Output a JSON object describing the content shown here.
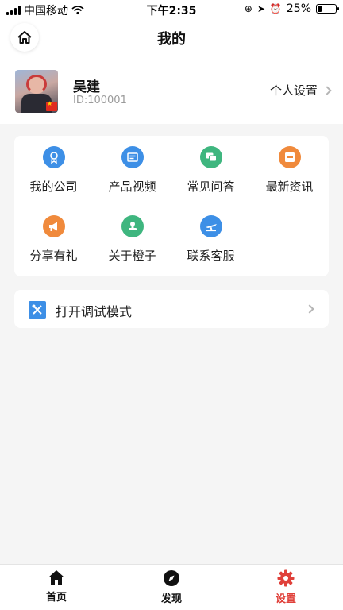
{
  "status_bar": {
    "carrier": "中国移动",
    "time": "下午2:35",
    "battery": "25%",
    "battery_level": 0.25
  },
  "header": {
    "title": "我的",
    "home_icon": "home-icon"
  },
  "profile": {
    "name": "吴建",
    "id_label": "ID:100001",
    "settings_label": "个人设置"
  },
  "grid": [
    {
      "label": "我的公司",
      "icon": "badge-icon",
      "color": "#3d8fe6"
    },
    {
      "label": "产品视频",
      "icon": "video-icon",
      "color": "#3d8fe6"
    },
    {
      "label": "常见问答",
      "icon": "chat-icon",
      "color": "#3fb67f"
    },
    {
      "label": "最新资讯",
      "icon": "news-icon",
      "color": "#f08a3c"
    },
    {
      "label": "分享有礼",
      "icon": "megaphone-icon",
      "color": "#f08a3c"
    },
    {
      "label": "关于橙子",
      "icon": "stamp-icon",
      "color": "#3fb67f"
    },
    {
      "label": "联系客服",
      "icon": "plane-icon",
      "color": "#3d8fe6"
    }
  ],
  "debug": {
    "label": "打开调试模式",
    "icon": "tools-icon"
  },
  "tabbar": {
    "items": [
      {
        "label": "首页",
        "icon": "home-icon"
      },
      {
        "label": "发现",
        "icon": "compass-icon"
      },
      {
        "label": "设置",
        "icon": "gear-icon"
      }
    ],
    "active_color": "#e0403a"
  }
}
